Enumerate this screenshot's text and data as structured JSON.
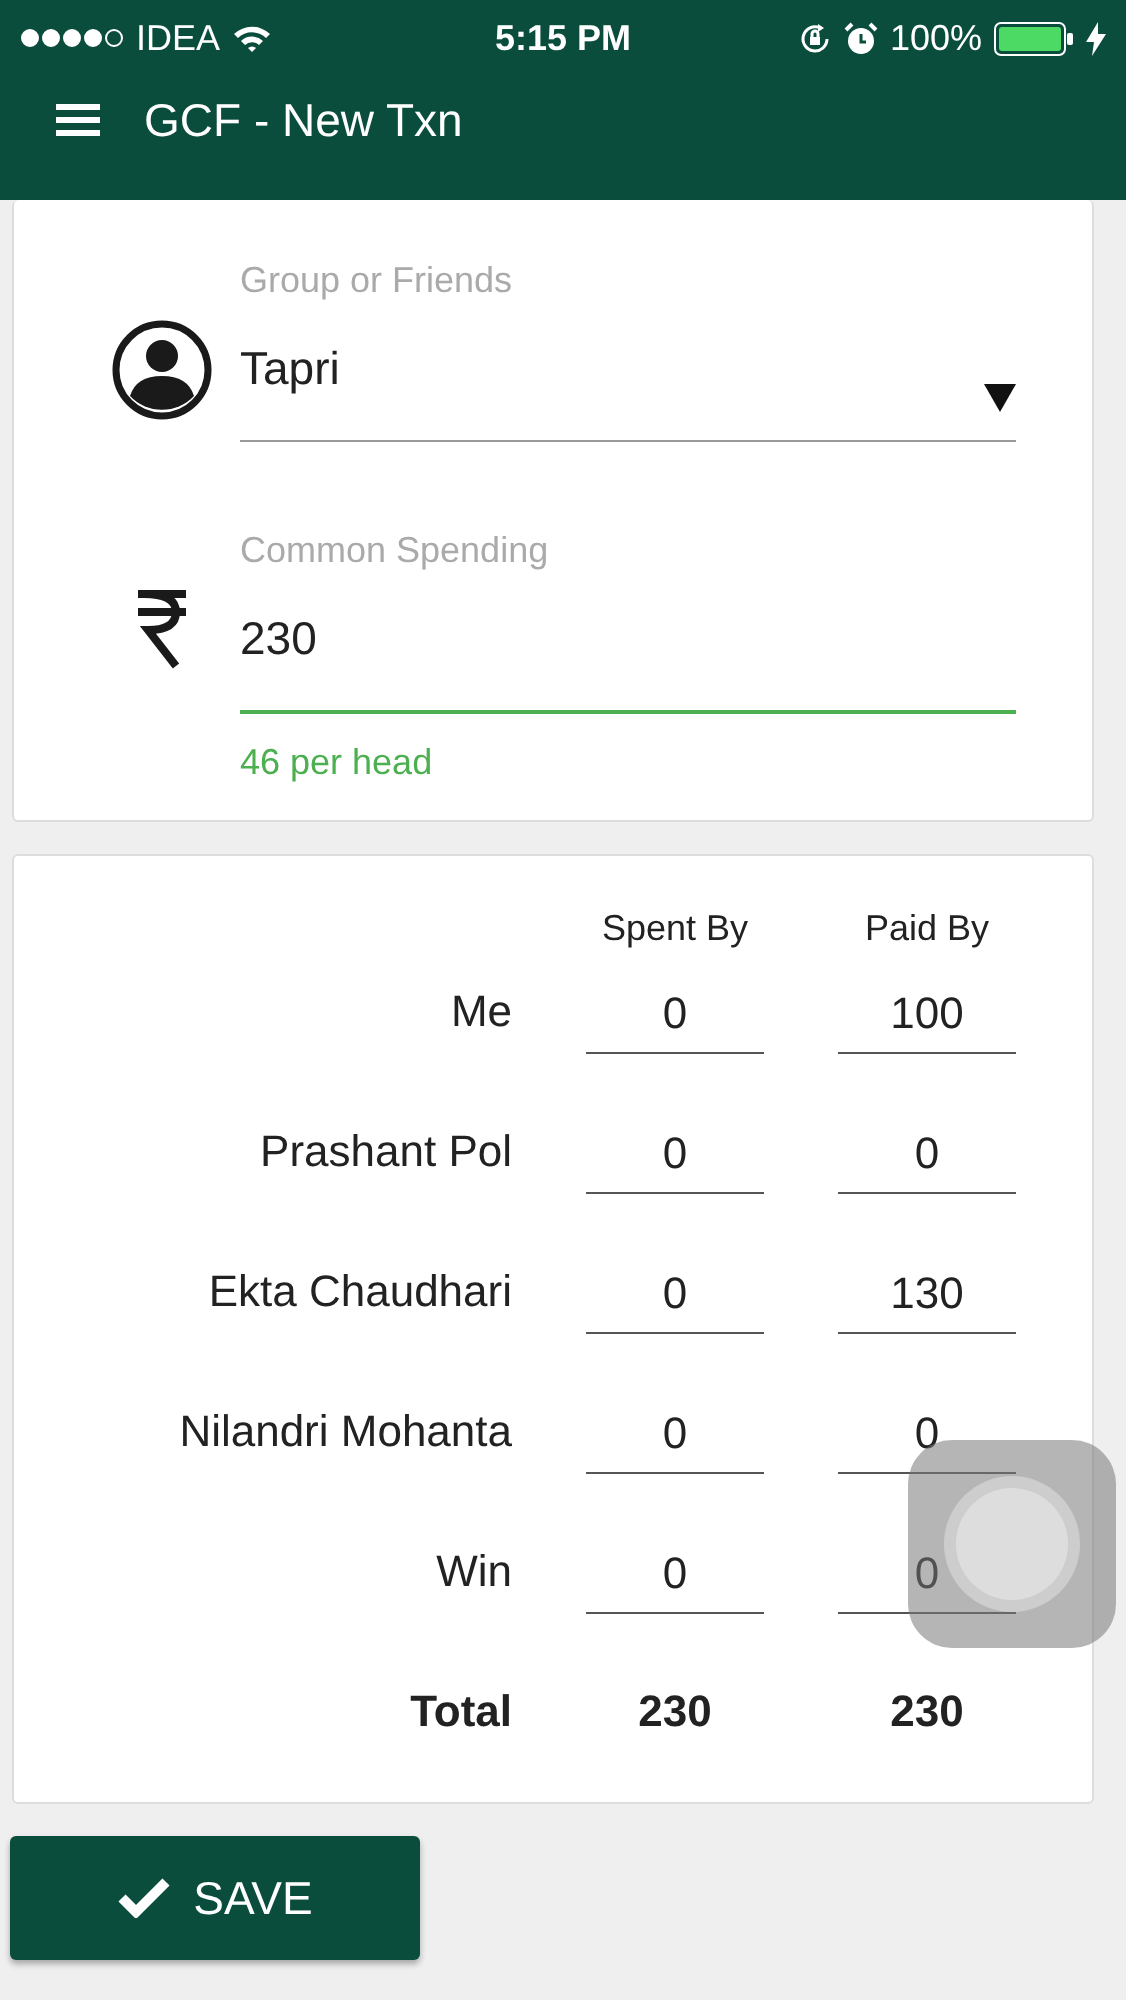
{
  "status_bar": {
    "carrier": "IDEA",
    "time": "5:15 PM",
    "battery": "100%"
  },
  "app_bar": {
    "title": "GCF - New Txn"
  },
  "form": {
    "fields": [
      {
        "kind": "select",
        "label": "Group or Friends",
        "value": "Tapri",
        "focused": false
      },
      {
        "kind": "amount",
        "label": "Common Spending",
        "value": "230",
        "focused": true,
        "helper": "46 per head"
      }
    ]
  },
  "split": {
    "columns": [
      "Spent By",
      "Paid By"
    ],
    "rows": [
      {
        "name": "Me",
        "spent": "0",
        "paid": "100"
      },
      {
        "name": "Prashant Pol",
        "spent": "0",
        "paid": "0"
      },
      {
        "name": "Ekta Chaudhari",
        "spent": "0",
        "paid": "130"
      },
      {
        "name": "Nilandri Mohanta",
        "spent": "0",
        "paid": "0"
      },
      {
        "name": "Win",
        "spent": "0",
        "paid": "0"
      }
    ],
    "total": {
      "label": "Total",
      "spent": "230",
      "paid": "230"
    }
  },
  "save_button": {
    "label": "SAVE"
  }
}
